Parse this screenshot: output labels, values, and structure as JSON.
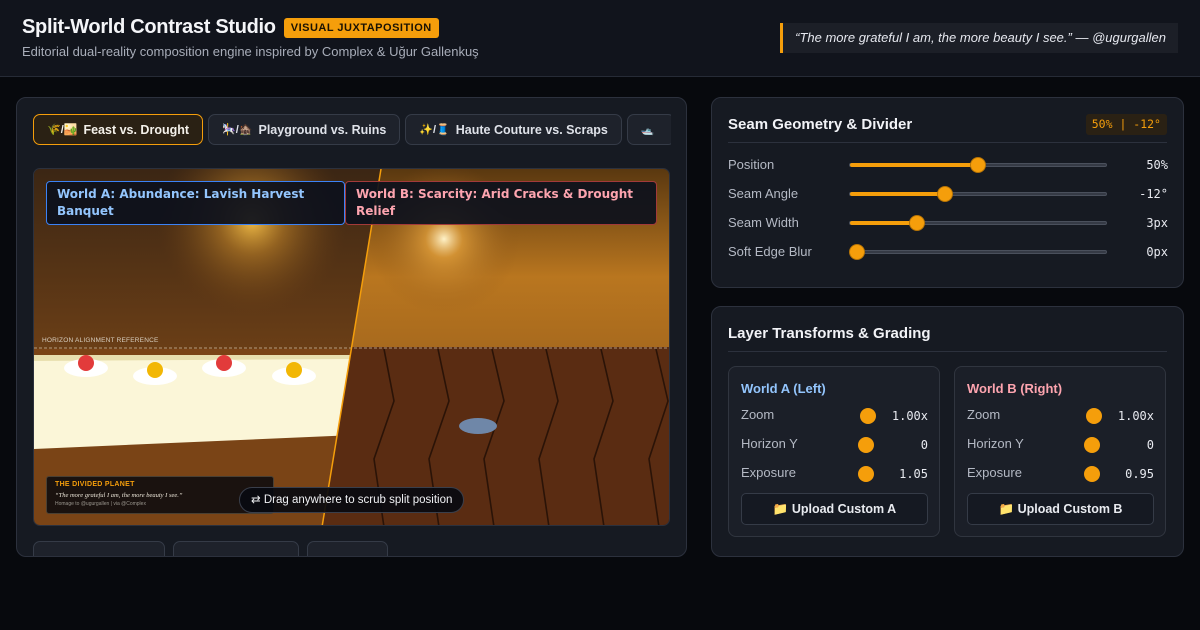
{
  "header": {
    "title": "Split-World Contrast Studio",
    "badge": "VISUAL JUXTAPOSITION",
    "subtitle": "Editorial dual-reality composition engine inspired by Complex & Uğur Gallenkuş",
    "quote": "“The more grateful I am, the more beauty I see.” — @ugurgallen"
  },
  "tabs": [
    {
      "icon": "🌾/🏜️",
      "label": "Feast vs. Drought",
      "active": true
    },
    {
      "icon": "🎠/🏚️",
      "label": "Playground vs. Ruins",
      "active": false
    },
    {
      "icon": "✨/🧵",
      "label": "Haute Couture vs. Scraps",
      "active": false
    },
    {
      "icon": "🛥️",
      "label": "",
      "active": false
    }
  ],
  "stage": {
    "world_a_label": "World A: Abundance: Lavish Harvest Banquet",
    "world_b_label": "World B: Scarcity: Arid Cracks & Drought Relief",
    "horizon_reference": "HORIZON ALIGNMENT REFERENCE",
    "plaque": {
      "title": "THE DIVIDED PLANET",
      "quote": "“The more grateful I am, the more beauty I see.”",
      "credit": "Homage to @ugurgallen | via @Complex"
    },
    "drag_hint": "⇄ Drag anywhere to scrub split position",
    "seam_position": 0.5,
    "seam_angle_deg": -12
  },
  "geometry": {
    "title": "Seam Geometry & Divider",
    "readout": "50% | -12°",
    "sliders": [
      {
        "label": "Position",
        "value": "50%",
        "fraction": 0.5
      },
      {
        "label": "Seam Angle",
        "value": "-12°",
        "fraction": 0.37
      },
      {
        "label": "Seam Width",
        "value": "3px",
        "fraction": 0.26
      },
      {
        "label": "Soft Edge Blur",
        "value": "0px",
        "fraction": 0.0
      }
    ]
  },
  "layers": {
    "title": "Layer Transforms & Grading",
    "world_a": {
      "title": "World A (Left)",
      "rows": [
        {
          "label": "Zoom",
          "value": "1.00x"
        },
        {
          "label": "Horizon Y",
          "value": "0"
        },
        {
          "label": "Exposure",
          "value": "1.05"
        }
      ],
      "upload": "📁 Upload Custom A"
    },
    "world_b": {
      "title": "World B (Right)",
      "rows": [
        {
          "label": "Zoom",
          "value": "1.00x"
        },
        {
          "label": "Horizon Y",
          "value": "0"
        },
        {
          "label": "Exposure",
          "value": "0.95"
        }
      ],
      "upload": "📁 Upload Custom B"
    }
  },
  "colors": {
    "accent": "#f59e0b",
    "world_a": "#93c5fd",
    "world_b": "#fda4af"
  }
}
